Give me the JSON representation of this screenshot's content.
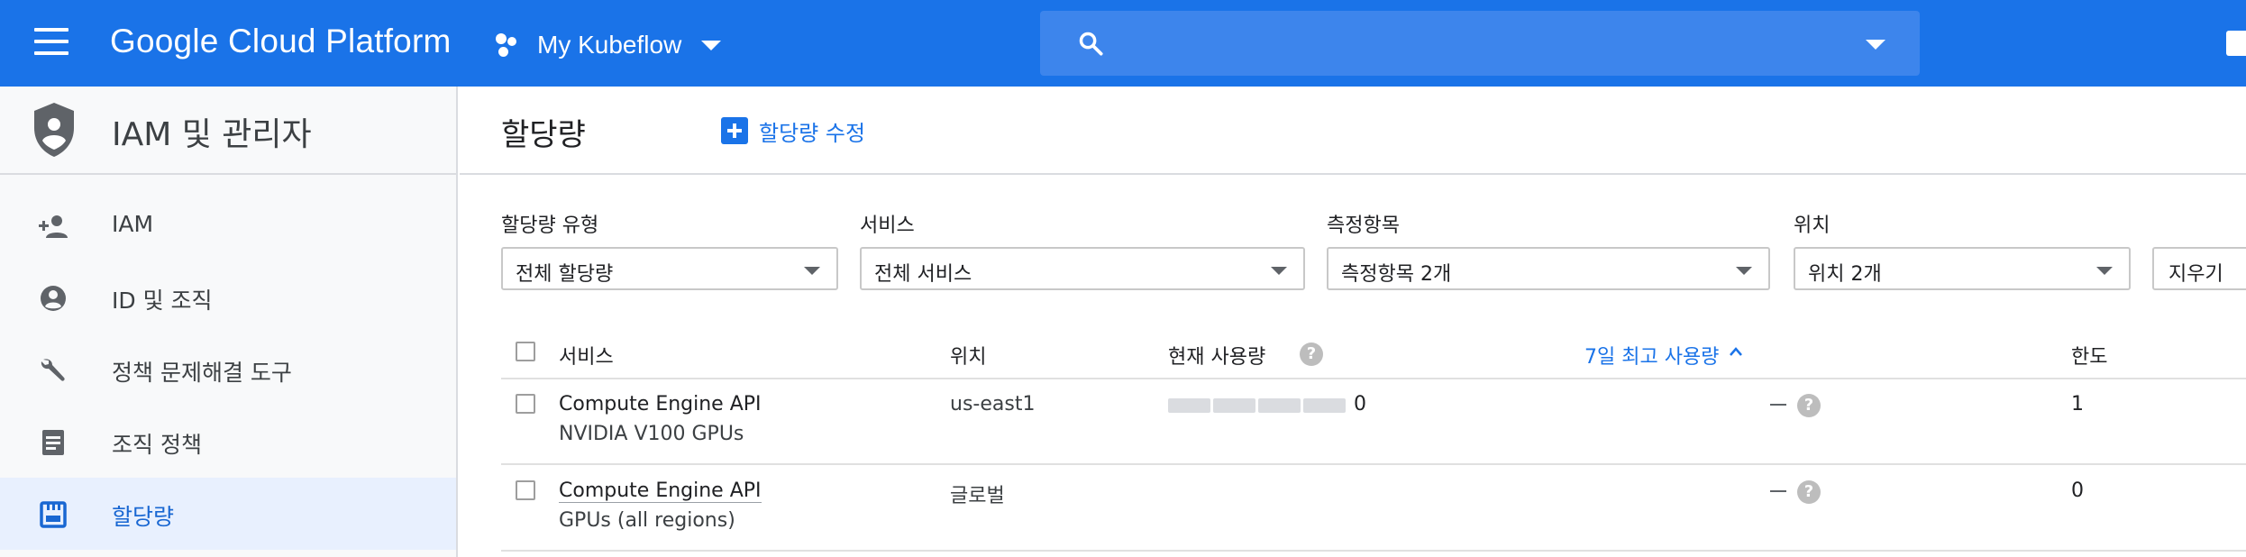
{
  "header": {
    "brand": "Google Cloud Platform",
    "project": "My Kubeflow",
    "search_placeholder": ""
  },
  "sidebar": {
    "title": "IAM 및 관리자",
    "items": [
      {
        "label": "IAM",
        "icon": "person-add-icon",
        "active": false
      },
      {
        "label": "ID 및 조직",
        "icon": "account-circle-icon",
        "active": false
      },
      {
        "label": "정책 문제해결 도구",
        "icon": "wrench-icon",
        "active": false
      },
      {
        "label": "조직 정책",
        "icon": "document-list-icon",
        "active": false
      },
      {
        "label": "할당량",
        "icon": "quota-icon",
        "active": true
      }
    ]
  },
  "main": {
    "title": "할당량",
    "edit_label": "할당량 수정",
    "filters": [
      {
        "label": "할당량 유형",
        "value": "전체 할당량"
      },
      {
        "label": "서비스",
        "value": "전체 서비스"
      },
      {
        "label": "측정항목",
        "value": "측정항목 2개"
      },
      {
        "label": "위치",
        "value": "위치 2개"
      }
    ],
    "clear_label": "지우기",
    "table": {
      "headers": {
        "service": "서비스",
        "location": "위치",
        "current_usage": "현재 사용량",
        "peak_usage": "7일 최고 사용량",
        "limit": "한도"
      },
      "rows": [
        {
          "service": "Compute Engine API",
          "metric": "NVIDIA V100 GPUs",
          "location": "us-east1",
          "current_usage": "0",
          "current_usage_fraction": 0,
          "peak_usage": "–",
          "limit": "1"
        },
        {
          "service": "Compute Engine API",
          "metric": "GPUs (all regions)",
          "location": "글로벌",
          "current_usage": "",
          "peak_usage": "–",
          "limit": "0"
        }
      ]
    }
  },
  "colors": {
    "topbar": "#1a73e8",
    "link": "#1a73e8",
    "active_bg": "#e8f0fe",
    "active_text": "#1967d2"
  }
}
